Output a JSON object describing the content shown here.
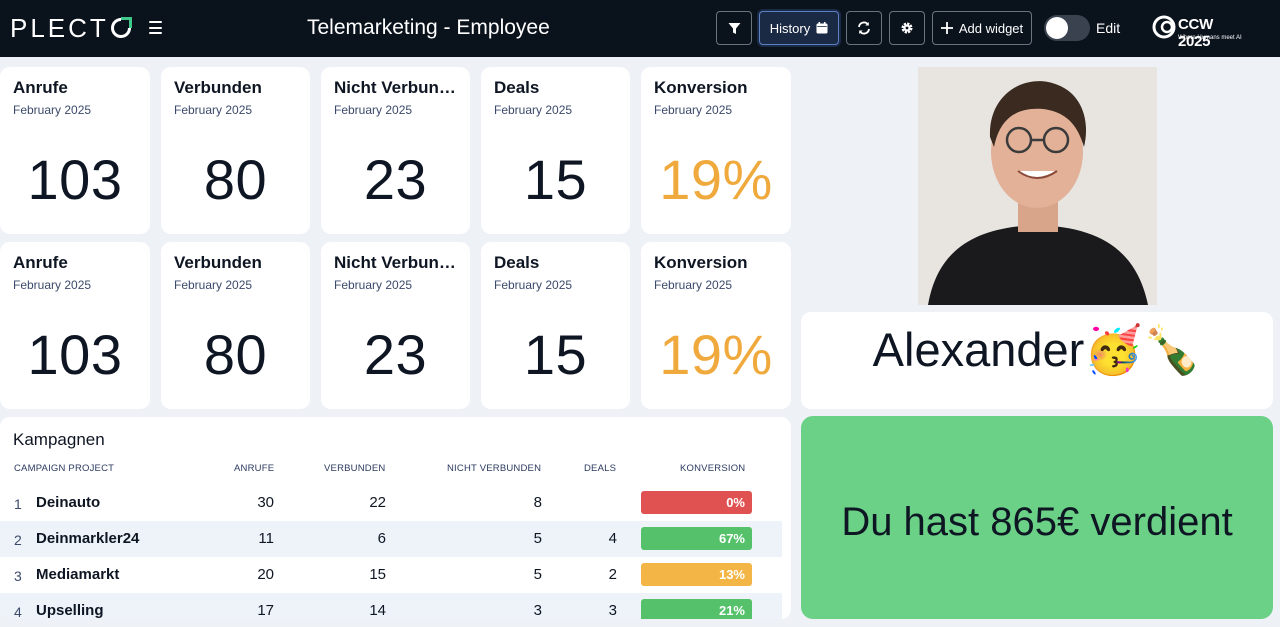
{
  "header": {
    "logo_text": "PLECT",
    "title": "Telemarketing - Employee",
    "history_label": "History",
    "add_widget_label": "Add widget",
    "edit_label": "Edit",
    "event_logo_text": "CCW 2025",
    "event_logo_tagline": "Where Humans meet AI"
  },
  "kpi_rows": [
    [
      {
        "title": "Anrufe",
        "period": "February 2025",
        "value": "103"
      },
      {
        "title": "Verbunden",
        "period": "February 2025",
        "value": "80"
      },
      {
        "title": "Nicht Verbun…",
        "period": "February 2025",
        "value": "23"
      },
      {
        "title": "Deals",
        "period": "February 2025",
        "value": "15"
      },
      {
        "title": "Konversion",
        "period": "February 2025",
        "value": "19%"
      }
    ],
    [
      {
        "title": "Anrufe",
        "period": "February 2025",
        "value": "103"
      },
      {
        "title": "Verbunden",
        "period": "February 2025",
        "value": "80"
      },
      {
        "title": "Nicht Verbun…",
        "period": "February 2025",
        "value": "23"
      },
      {
        "title": "Deals",
        "period": "February 2025",
        "value": "15"
      },
      {
        "title": "Konversion",
        "period": "February 2025",
        "value": "19%"
      }
    ]
  ],
  "campaigns": {
    "title": "Kampagnen",
    "columns": [
      "CAMPAIGN PROJECT",
      "ANRUFE",
      "VERBUNDEN",
      "NICHT VERBUNDEN",
      "DEALS",
      "KONVERSION"
    ],
    "rows": [
      {
        "index": "1",
        "name": "Deinauto",
        "anrufe": "30",
        "verbunden": "22",
        "nicht_verbunden": "8",
        "deals": "",
        "konversion": "0%",
        "color": "#e05252"
      },
      {
        "index": "2",
        "name": "Deinmarkler24",
        "anrufe": "11",
        "verbunden": "6",
        "nicht_verbunden": "5",
        "deals": "4",
        "konversion": "67%",
        "color": "#55c16a"
      },
      {
        "index": "3",
        "name": "Mediamarkt",
        "anrufe": "20",
        "verbunden": "15",
        "nicht_verbunden": "5",
        "deals": "2",
        "konversion": "13%",
        "color": "#f3b545"
      },
      {
        "index": "4",
        "name": "Upselling",
        "anrufe": "17",
        "verbunden": "14",
        "nicht_verbunden": "3",
        "deals": "3",
        "konversion": "21%",
        "color": "#55c16a"
      }
    ]
  },
  "employee": {
    "name": "Alexander🥳🍾"
  },
  "earnings": {
    "text": "Du hast 865€ verdient"
  },
  "colors": {
    "topbar": "#0a121c",
    "accent_value": "#efa93c",
    "earnings_bg": "#6ad186"
  }
}
